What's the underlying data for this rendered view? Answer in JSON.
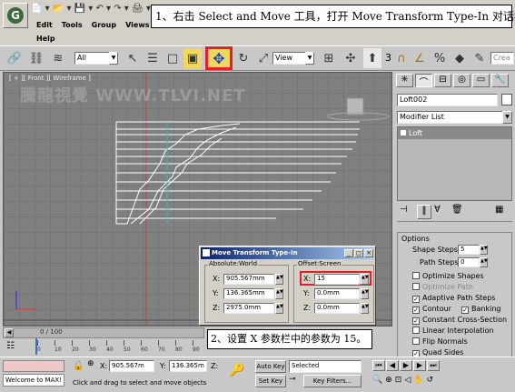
{
  "annotations": {
    "step1": "1、右击 Select and Move 工具，打开 Move Transform Type-In 对话框。",
    "step2": "2、设置 X 参数栏中的参数为 15。"
  },
  "menu": {
    "items": [
      "Edit",
      "Tools",
      "Group",
      "Views"
    ],
    "help": "Help"
  },
  "toolbar": {
    "selection_filter": "All",
    "ref_coord": "View",
    "named_sel_placeholder": "Crea",
    "snap_label": "3"
  },
  "viewport": {
    "label": "[ + ][ Front ][ Wireframe ]",
    "watermark": "騰龍視覺 WWW.TLVI.NET"
  },
  "dialog": {
    "title": "Move Transform Type-In",
    "absolute_group": "Absolute:World",
    "offset_group": "Offset:Screen",
    "abs_fields": [
      {
        "label": "X:",
        "value": "905.567mm"
      },
      {
        "label": "Y:",
        "value": "136.365mm"
      },
      {
        "label": "Z:",
        "value": "2975.0mm"
      }
    ],
    "offset_fields": [
      {
        "label": "X:",
        "value": "15"
      },
      {
        "label": "Y:",
        "value": "0.0mm"
      },
      {
        "label": "Z:",
        "value": "0.0mm"
      }
    ]
  },
  "panel": {
    "object_name": "Loft002",
    "modifier_list": "Modifier List",
    "stack_item": "Loft",
    "rollout_title": "Options",
    "shape_steps_label": "Shape Steps:",
    "shape_steps": "5",
    "path_steps_label": "Path Steps:",
    "path_steps": "0",
    "options": [
      {
        "label": "Optimize Shapes",
        "checked": false,
        "disabled": false
      },
      {
        "label": "Optimize Path",
        "checked": false,
        "disabled": true
      },
      {
        "label": "Adaptive Path Steps",
        "checked": true,
        "disabled": false
      },
      {
        "label": "Contour",
        "checked": true,
        "disabled": false
      },
      {
        "label": "Constant Cross-Section",
        "checked": true,
        "disabled": false
      },
      {
        "label": "Linear Interpolation",
        "checked": false,
        "disabled": false
      },
      {
        "label": "Flip Normals",
        "checked": false,
        "disabled": false
      },
      {
        "label": "Quad Sides",
        "checked": true,
        "disabled": false
      }
    ],
    "banking_label": "Banking"
  },
  "timeline": {
    "frame": "0 / 100",
    "ticks": [
      "0",
      "10",
      "20",
      "30",
      "40",
      "50",
      "60",
      "70",
      "80",
      "90"
    ]
  },
  "status": {
    "maxscript": "Welcome to MAX!",
    "x": "905.567m",
    "y": "136.365m",
    "z": "Z:",
    "auto_key": "Auto Key",
    "set_key": "Set Key",
    "selected": "Selected",
    "key_filters": "Key Filters...",
    "prompt": "Click and drag to select and move objects"
  },
  "colors": {
    "highlight": "#e0212a",
    "annotation_border": "#000000",
    "viewport_bg": "#808080",
    "cyan_line": "#40b8b8"
  }
}
